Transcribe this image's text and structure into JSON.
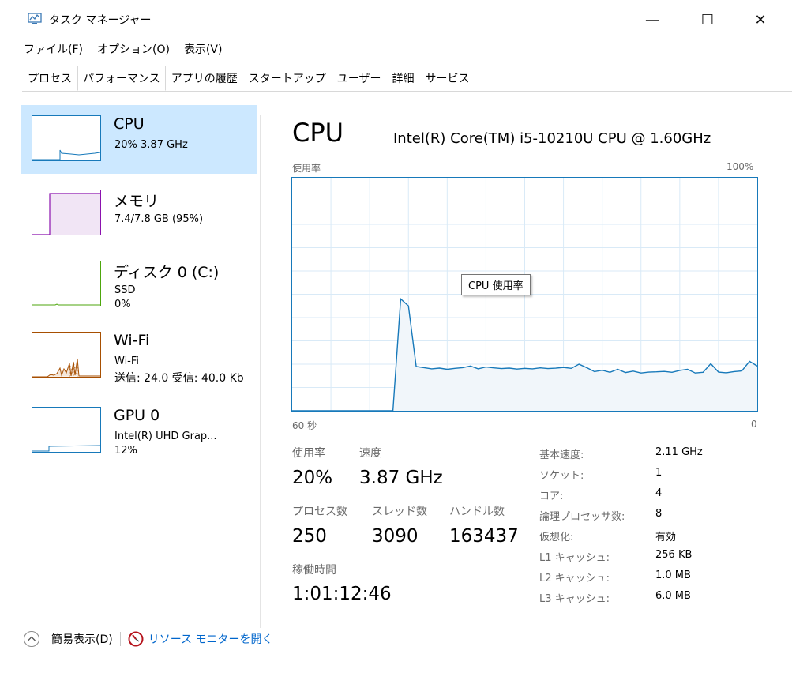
{
  "window": {
    "title": "タスク マネージャー",
    "minimize": "—",
    "maximize": "☐",
    "close": "✕"
  },
  "menu": [
    "ファイル(F)",
    "オプション(O)",
    "表示(V)"
  ],
  "tabs": [
    "プロセス",
    "パフォーマンス",
    "アプリの履歴",
    "スタートアップ",
    "ユーザー",
    "詳細",
    "サービス"
  ],
  "active_tab": "パフォーマンス",
  "colors": {
    "cpu": "#1779ba",
    "memory": "#8b12ae",
    "disk": "#4da60c",
    "wifi": "#a74f01",
    "gpu": "#1779ba",
    "selected": "#cce8ff"
  },
  "sidebar": [
    {
      "name": "CPU",
      "line1": "20% 3.87 GHz",
      "line2": ""
    },
    {
      "name": "メモリ",
      "line1": "7.4/7.8 GB (95%)",
      "line2": ""
    },
    {
      "name": "ディスク 0 (C:)",
      "line1": "SSD",
      "line2": "0%"
    },
    {
      "name": "Wi-Fi",
      "line1": "Wi-Fi",
      "line2": "送信: 24.0 受信: 40.0 Kb"
    },
    {
      "name": "GPU 0",
      "line1": "Intel(R) UHD Grap...",
      "line2": "12%"
    }
  ],
  "main": {
    "title": "CPU",
    "model": "Intel(R) Core(TM) i5-10210U CPU @ 1.60GHz",
    "graph_label": "使用率",
    "graph_max": "100%",
    "graph_time": "60 秒",
    "graph_min": "0",
    "tooltip": "CPU 使用率",
    "usage_samples": [
      0,
      0,
      0,
      0,
      0,
      0,
      0,
      0,
      0,
      0,
      0,
      0,
      0,
      0,
      48,
      45,
      19,
      18.5,
      18,
      18.3,
      17.8,
      18.2,
      18.5,
      19.2,
      18,
      18.8,
      18.4,
      18.1,
      18.3,
      17.9,
      18.2,
      18,
      18.4,
      18.1,
      18.3,
      18.6,
      18.2,
      20,
      18.5,
      16.8,
      17.4,
      16.5,
      17.8,
      16.4,
      17,
      16.2,
      16.6,
      16.7,
      16.9,
      16.5,
      17.3,
      17.8,
      16.2,
      16.5,
      20.2,
      16.6,
      16.3,
      16.8,
      17.1,
      21.2,
      19.2
    ],
    "stats": {
      "usage_label": "使用率",
      "usage": "20%",
      "speed_label": "速度",
      "speed": "3.87 GHz",
      "processes_label": "プロセス数",
      "processes": "250",
      "threads_label": "スレッド数",
      "threads": "3090",
      "handles_label": "ハンドル数",
      "handles": "163437",
      "uptime_label": "稼働時間",
      "uptime": "1:01:12:46"
    },
    "details": [
      {
        "key": "基本速度:",
        "value": "2.11 GHz"
      },
      {
        "key": "ソケット:",
        "value": "1"
      },
      {
        "key": "コア:",
        "value": "4"
      },
      {
        "key": "論理プロセッサ数:",
        "value": "8"
      },
      {
        "key": "仮想化:",
        "value": "有効"
      },
      {
        "key": "L1 キャッシュ:",
        "value": "256 KB"
      },
      {
        "key": "L2 キャッシュ:",
        "value": "1.0 MB"
      },
      {
        "key": "L3 キャッシュ:",
        "value": "6.0 MB"
      }
    ]
  },
  "footer": {
    "fewer_details": "簡易表示(D)",
    "resource_monitor": "リソース モニターを開く"
  }
}
